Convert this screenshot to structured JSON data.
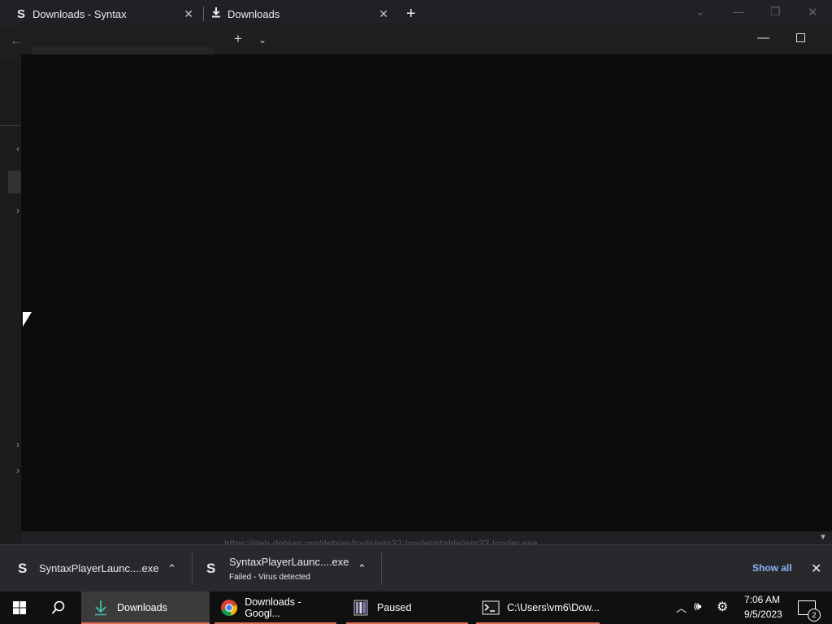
{
  "browser": {
    "tabs": [
      {
        "icon": "S",
        "title": "Downloads - Syntax"
      },
      {
        "icon": "download-icon",
        "title": "Downloads"
      }
    ],
    "background_url": "https://deb.debian.org/debian/tools/win32-loader/stable/win32-loader.exe"
  },
  "download_shelf": {
    "items": [
      {
        "icon": "S",
        "name": "SyntaxPlayerLaunc....exe",
        "status": ""
      },
      {
        "icon": "S",
        "name": "SyntaxPlayerLaunc....exe",
        "status": "Failed - Virus detected"
      }
    ],
    "show_all_label": "Show all"
  },
  "taskbar": {
    "apps": [
      {
        "label": "Downloads",
        "icon": "download-arrow-icon",
        "active": true
      },
      {
        "label": "Downloads - Googl...",
        "icon": "chrome-icon"
      },
      {
        "label": "Paused",
        "icon": "winrar-icon"
      },
      {
        "label": "C:\\Users\\vm6\\Dow...",
        "icon": "terminal-icon"
      }
    ],
    "clock": {
      "time": "7:06 AM",
      "date": "9/5/2023"
    },
    "notification_count": "2"
  },
  "colors": {
    "accent_underline": "#e06c57",
    "link": "#8ab4f8",
    "terminal_bg": "#0c0c0c"
  }
}
